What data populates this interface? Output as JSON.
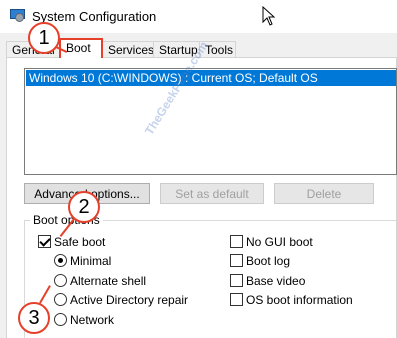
{
  "window": {
    "title": "System Configuration",
    "icon": "msconfig-icon"
  },
  "tabs": [
    {
      "label": "General"
    },
    {
      "label": "Boot",
      "active": true
    },
    {
      "label": "Services"
    },
    {
      "label": "Startup"
    },
    {
      "label": "Tools"
    }
  ],
  "os_list": {
    "items": [
      "Windows 10 (C:\\WINDOWS) : Current OS; Default OS"
    ]
  },
  "buttons": {
    "advanced": "Advanced options...",
    "set_default": "Set as default",
    "delete": "Delete"
  },
  "boot_options": {
    "label": "Boot options",
    "safe_boot": {
      "label": "Safe boot",
      "checked": true
    },
    "minimal": {
      "label": "Minimal",
      "selected": true
    },
    "alternate_shell": {
      "label": "Alternate shell",
      "selected": false
    },
    "ad_repair": {
      "label": "Active Directory repair",
      "selected": false
    },
    "network": {
      "label": "Network",
      "selected": false
    },
    "no_gui_boot": {
      "label": "No GUI boot",
      "checked": false
    },
    "boot_log": {
      "label": "Boot log",
      "checked": false
    },
    "base_video": {
      "label": "Base video",
      "checked": false
    },
    "os_boot_info": {
      "label": "OS boot information",
      "checked": false
    }
  },
  "annotations": [
    "1",
    "2",
    "3"
  ],
  "watermark": "TheGeekPage.com",
  "colors": {
    "selection": "#0078d7",
    "annotation": "#e5412a"
  }
}
